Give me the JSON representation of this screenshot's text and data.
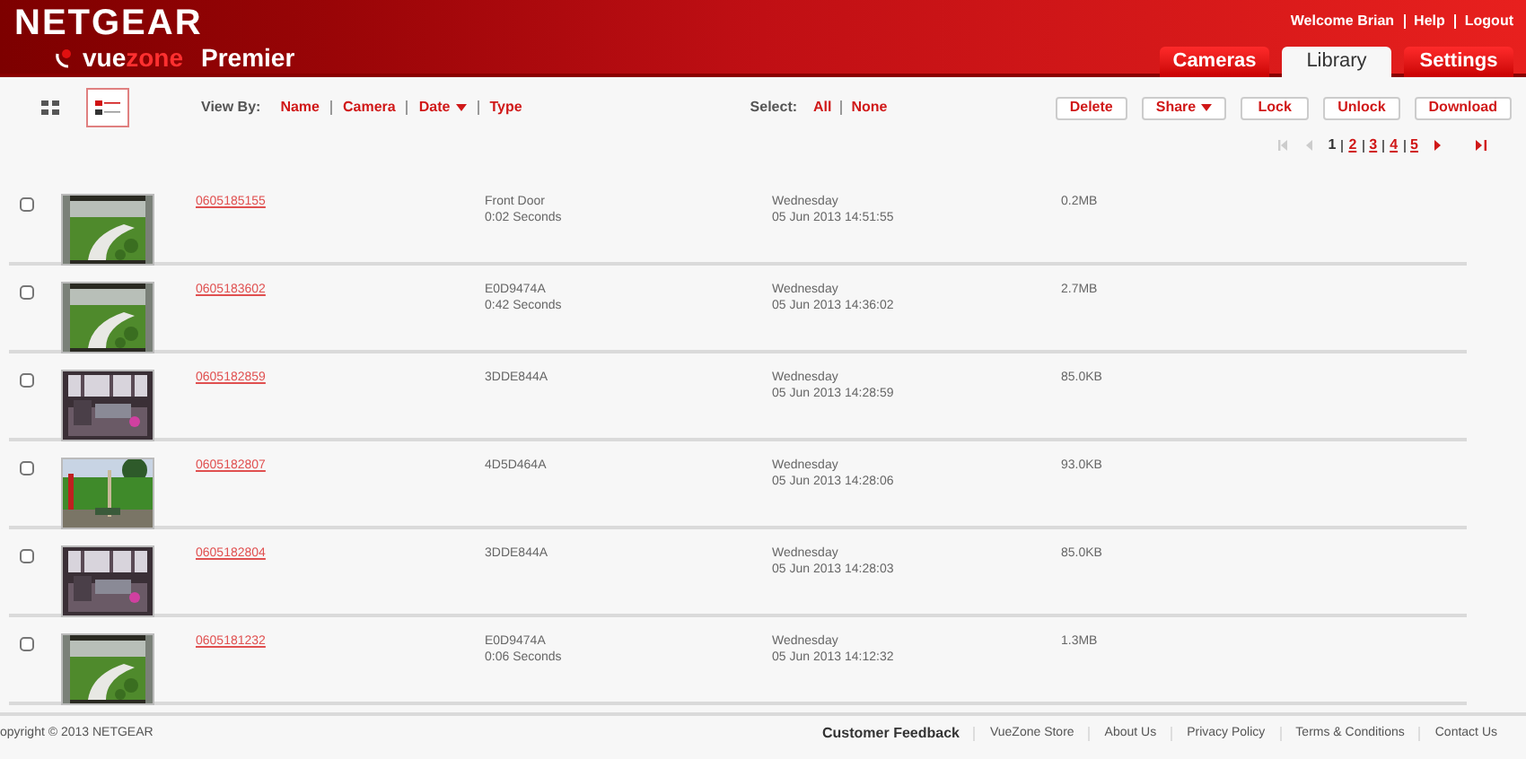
{
  "header": {
    "brand": "NETGEAR",
    "product_prefix": "vue",
    "product_suffix": "zone",
    "edition": "Premier",
    "user_links": [
      "Welcome Brian",
      "Help",
      "Logout"
    ]
  },
  "tabs": [
    {
      "label": "Cameras",
      "selected": false
    },
    {
      "label": "Library",
      "selected": true
    },
    {
      "label": "Settings",
      "selected": false
    }
  ],
  "view_modes": [
    {
      "kind": "grid",
      "selected": false
    },
    {
      "kind": "list",
      "selected": true
    }
  ],
  "view_by": {
    "label": "View By:",
    "options": [
      {
        "label": "Name",
        "dropdown": false
      },
      {
        "label": "Camera",
        "dropdown": false
      },
      {
        "label": "Date",
        "dropdown": true
      },
      {
        "label": "Type",
        "dropdown": false
      }
    ]
  },
  "select": {
    "label": "Select:",
    "options": [
      "All",
      "None"
    ]
  },
  "actions": [
    {
      "label": "Delete",
      "dropdown": false
    },
    {
      "label": "Share",
      "dropdown": true
    },
    {
      "label": "Lock",
      "dropdown": false
    },
    {
      "label": "Unlock",
      "dropdown": false
    },
    {
      "label": "Download",
      "dropdown": false
    }
  ],
  "pagination": {
    "pages": [
      {
        "label": "1",
        "selected": true
      },
      {
        "label": "2",
        "selected": false
      },
      {
        "label": "3",
        "selected": false
      },
      {
        "label": "4",
        "selected": false
      },
      {
        "label": "5",
        "selected": false
      }
    ],
    "first_disabled": true,
    "prev_disabled": true,
    "next_disabled": false,
    "last_disabled": false
  },
  "clips": [
    {
      "checked": false,
      "name": "0605185155",
      "camera": "Front Door",
      "duration": "0:02 Seconds",
      "day": "Wednesday",
      "date": "05 Jun 2013 14:51:55",
      "size": "0.2MB"
    },
    {
      "checked": false,
      "name": "0605183602",
      "camera": "E0D9474A",
      "duration": "0:42 Seconds",
      "day": "Wednesday",
      "date": "05 Jun 2013 14:36:02",
      "size": "2.7MB"
    },
    {
      "checked": false,
      "name": "0605182859",
      "camera": "3DDE844A",
      "day": "Wednesday",
      "date": "05 Jun 2013 14:28:59",
      "size": "85.0KB"
    },
    {
      "checked": false,
      "name": "0605182807",
      "camera": "4D5D464A",
      "day": "Wednesday",
      "date": "05 Jun 2013 14:28:06",
      "size": "93.0KB"
    },
    {
      "checked": false,
      "name": "0605182804",
      "camera": "3DDE844A",
      "day": "Wednesday",
      "date": "05 Jun 2013 14:28:03",
      "size": "85.0KB"
    },
    {
      "checked": false,
      "name": "0605181232",
      "camera": "E0D9474A",
      "duration": "0:06 Seconds",
      "day": "Wednesday",
      "date": "05 Jun 2013 14:12:32",
      "size": "1.3MB"
    }
  ],
  "footer": {
    "copyright": "opyright © 2013 NETGEAR",
    "links": [
      "Customer Feedback",
      "VueZone Store",
      "About Us",
      "Privacy Policy",
      "Terms & Conditions",
      "Contact Us"
    ]
  }
}
